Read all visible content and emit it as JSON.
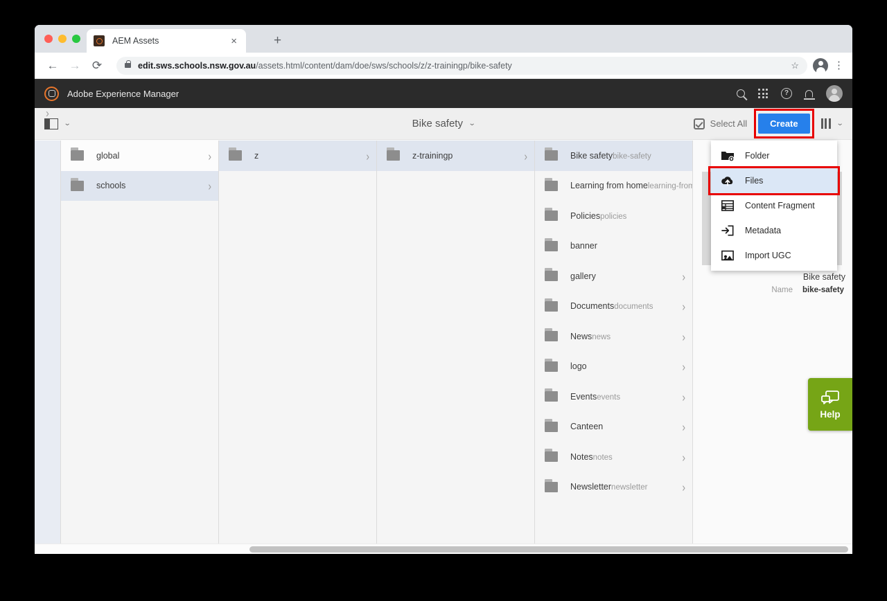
{
  "browser": {
    "tab": {
      "title": "AEM Assets",
      "favicon": "aem-favicon",
      "close": "×"
    },
    "new_tab": "+",
    "nav": {
      "back": "←",
      "forward": "→",
      "reload": "⟳"
    },
    "url": {
      "host": "edit.sws.schools.nsw.gov.au",
      "path": "/assets.html/content/dam/doe/sws/schools/z/z-trainingp/bike-safety",
      "lock": "secure-lock-icon",
      "star": "☆"
    },
    "menu": "⋮"
  },
  "header": {
    "product_title": "Adobe Experience Manager",
    "icons": [
      "search-icon",
      "apps-grid-icon",
      "help-icon",
      "notifications-icon",
      "avatar-icon"
    ],
    "help_glyph": "?"
  },
  "toolbar": {
    "rail_toggle": "rail-toggle-icon",
    "rail_chevron": "⌄",
    "title": "Bike safety",
    "title_chevron": "⌄",
    "select_all": "Select All",
    "create_label": "Create",
    "view_chevron": "⌄",
    "accent_color": "#2680eb",
    "highlight_color": "#e80000"
  },
  "columns": [
    {
      "name": "column-1",
      "items": [
        {
          "title": "global",
          "sub": "",
          "chevron": "›",
          "state": "hovered"
        },
        {
          "title": "schools",
          "sub": "",
          "chevron": "›",
          "state": "selected"
        }
      ]
    },
    {
      "name": "column-2",
      "items": [
        {
          "title": "z",
          "sub": "",
          "chevron": "›",
          "state": "selected"
        }
      ]
    },
    {
      "name": "column-3",
      "items": [
        {
          "title": "z-trainingp",
          "sub": "",
          "chevron": "›",
          "state": "selected"
        }
      ]
    },
    {
      "name": "column-4",
      "items": [
        {
          "title": "Bike safety",
          "sub": "bike-safety",
          "chevron": "",
          "state": "selected"
        },
        {
          "title": "Learning from home",
          "sub": "learning-from-home",
          "chevron": "",
          "state": ""
        },
        {
          "title": "Policies",
          "sub": "policies",
          "chevron": "",
          "state": ""
        },
        {
          "title": "banner",
          "sub": "",
          "chevron": "",
          "state": ""
        },
        {
          "title": "gallery",
          "sub": "",
          "chevron": "›",
          "state": ""
        },
        {
          "title": "Documents",
          "sub": "documents",
          "chevron": "›",
          "state": ""
        },
        {
          "title": "News",
          "sub": "news",
          "chevron": "›",
          "state": ""
        },
        {
          "title": "logo",
          "sub": "",
          "chevron": "›",
          "state": ""
        },
        {
          "title": "Events",
          "sub": "events",
          "chevron": "›",
          "state": ""
        },
        {
          "title": "Canteen",
          "sub": "",
          "chevron": "›",
          "state": ""
        },
        {
          "title": "Notes",
          "sub": "notes",
          "chevron": "›",
          "state": ""
        },
        {
          "title": "Newsletter",
          "sub": "newsletter",
          "chevron": "›",
          "state": ""
        }
      ]
    }
  ],
  "rail": {
    "chevron": "›"
  },
  "detail": {
    "title": "Bike safety",
    "name_label": "Name",
    "name_value": "bike-safety"
  },
  "create_menu": {
    "items": [
      {
        "label": "Folder",
        "icon": "new-folder-icon",
        "active": false
      },
      {
        "label": "Files",
        "icon": "cloud-upload-icon",
        "active": true
      },
      {
        "label": "Content Fragment",
        "icon": "content-fragment-icon",
        "active": false
      },
      {
        "label": "Metadata",
        "icon": "metadata-import-icon",
        "active": false
      },
      {
        "label": "Import UGC",
        "icon": "import-ugc-icon",
        "active": false
      }
    ]
  },
  "help_widget": {
    "label": "Help",
    "icon": "chat-bubbles-icon",
    "color": "#76a516"
  }
}
